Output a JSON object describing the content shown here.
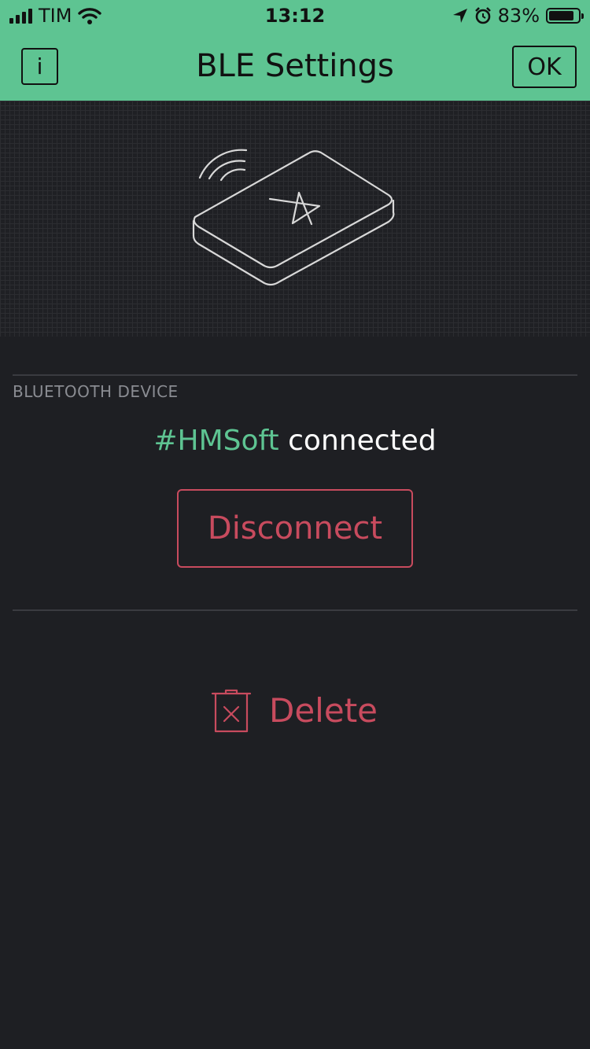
{
  "status_bar": {
    "carrier": "TIM",
    "time": "13:12",
    "battery_percent": "83%"
  },
  "header": {
    "title": "BLE Settings",
    "info_label": "i",
    "ok_label": "OK"
  },
  "device_section": {
    "label": "BLUETOOTH DEVICE",
    "device_name": "#HMSoft",
    "device_status": "connected",
    "disconnect_label": "Disconnect"
  },
  "delete": {
    "label": "Delete"
  },
  "colors": {
    "accent": "#5ec492",
    "danger": "#c84b5e",
    "background": "#1e1f23"
  },
  "icons": {
    "signal": "cellular-signal-icon",
    "wifi": "wifi-icon",
    "location": "location-arrow-icon",
    "alarm": "alarm-clock-icon",
    "battery": "battery-icon",
    "hero": "ble-device-illustration",
    "delete": "trash-icon"
  }
}
